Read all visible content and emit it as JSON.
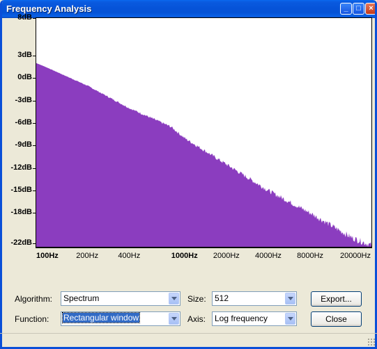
{
  "window": {
    "title": "Frequency Analysis"
  },
  "title_buttons": {
    "minimize": "_",
    "maximize": "□",
    "close": "×"
  },
  "chart_data": {
    "type": "area",
    "y_ticks": [
      "8dB",
      "3dB",
      "0dB",
      "-3dB",
      "-6dB",
      "-9dB",
      "-12dB",
      "-15dB",
      "-18dB",
      "-22dB"
    ],
    "x_ticks": [
      "100Hz",
      "200Hz",
      "400Hz",
      "1000Hz",
      "2000Hz",
      "4000Hz",
      "8000Hz",
      "20000Hz"
    ],
    "x_scale": "log",
    "ylim": [
      -22.5,
      8
    ],
    "xlim": [
      86,
      22050
    ],
    "fill_color": "#8b3dbf",
    "series": [
      {
        "x": [
          86,
          100,
          200,
          400,
          800,
          1000,
          2000,
          4000,
          8000,
          16000,
          22050
        ],
        "values": [
          2.0,
          1.5,
          -1.0,
          -4.0,
          -6.5,
          -8.0,
          -11.5,
          -15.0,
          -18.0,
          -21.3,
          -22.3
        ]
      }
    ]
  },
  "controls": {
    "algorithm_label": "Algorithm:",
    "algorithm_value": "Spectrum",
    "function_label": "Function:",
    "function_value": "Rectangular window",
    "size_label": "Size:",
    "size_value": "512",
    "axis_label": "Axis:",
    "axis_value": "Log frequency",
    "export_button": "Export...",
    "close_button": "Close"
  }
}
